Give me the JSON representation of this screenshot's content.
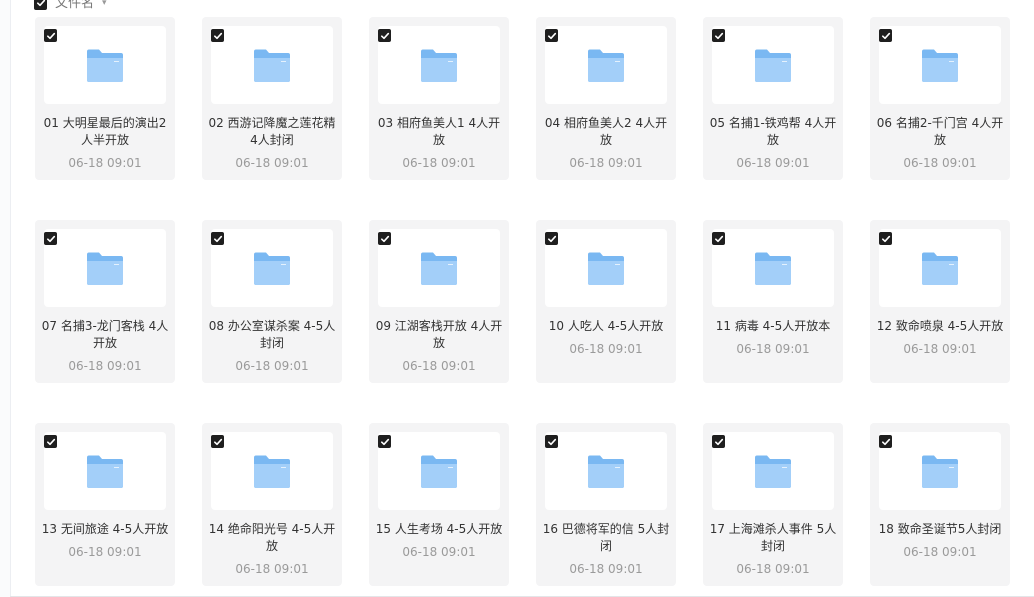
{
  "header": {
    "select_all_checked": true,
    "column_label": "文件名",
    "sort_indicator": "▾"
  },
  "folder_color": "#7ab8f2",
  "files": [
    {
      "name": "01 大明星最后的演出2人半开放",
      "date": "06-18 09:01",
      "checked": true,
      "icon": "folder-icon"
    },
    {
      "name": "02 西游记降魔之莲花精 4人封闭",
      "date": "06-18 09:01",
      "checked": true,
      "icon": "folder-icon"
    },
    {
      "name": "03 相府鱼美人1 4人开放",
      "date": "06-18 09:01",
      "checked": true,
      "icon": "folder-icon"
    },
    {
      "name": "04 相府鱼美人2 4人开放",
      "date": "06-18 09:01",
      "checked": true,
      "icon": "folder-icon"
    },
    {
      "name": "05 名捕1-铁鸡帮 4人开放",
      "date": "06-18 09:01",
      "checked": true,
      "icon": "folder-icon"
    },
    {
      "name": "06 名捕2-千门宫 4人开放",
      "date": "06-18 09:01",
      "checked": true,
      "icon": "folder-icon"
    },
    {
      "name": "07 名捕3-龙门客栈 4人开放",
      "date": "06-18 09:01",
      "checked": true,
      "icon": "folder-icon"
    },
    {
      "name": "08 办公室谋杀案 4-5人封闭",
      "date": "06-18 09:01",
      "checked": true,
      "icon": "folder-icon"
    },
    {
      "name": "09 江湖客栈开放 4人开放",
      "date": "06-18 09:01",
      "checked": true,
      "icon": "folder-icon"
    },
    {
      "name": "10 人吃人 4-5人开放",
      "date": "06-18 09:01",
      "checked": true,
      "icon": "folder-icon"
    },
    {
      "name": "11 病毒 4-5人开放本",
      "date": "06-18 09:01",
      "checked": true,
      "icon": "folder-icon"
    },
    {
      "name": "12 致命喷泉 4-5人开放",
      "date": "06-18 09:01",
      "checked": true,
      "icon": "folder-icon"
    },
    {
      "name": "13 无间旅途 4-5人开放",
      "date": "06-18 09:01",
      "checked": true,
      "icon": "folder-icon"
    },
    {
      "name": "14 绝命阳光号 4-5人开放",
      "date": "06-18 09:01",
      "checked": true,
      "icon": "folder-icon"
    },
    {
      "name": "15 人生考场 4-5人开放",
      "date": "06-18 09:01",
      "checked": true,
      "icon": "folder-icon"
    },
    {
      "name": "16 巴德将军的信 5人封闭",
      "date": "06-18 09:01",
      "checked": true,
      "icon": "folder-icon"
    },
    {
      "name": "17 上海滩杀人事件 5人封闭",
      "date": "06-18 09:01",
      "checked": true,
      "icon": "folder-icon"
    },
    {
      "name": "18 致命圣诞节5人封闭",
      "date": "06-18 09:01",
      "checked": true,
      "icon": "folder-icon"
    }
  ]
}
